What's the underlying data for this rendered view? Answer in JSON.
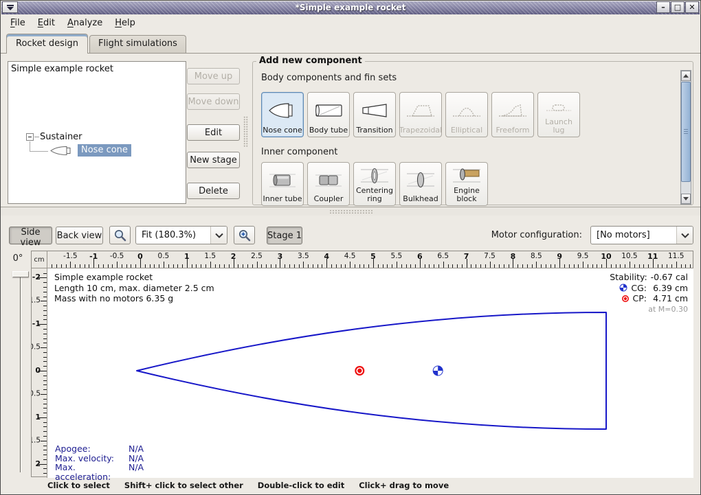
{
  "window": {
    "title": "*Simple example rocket",
    "controls": {
      "minimize": "–",
      "maximize": "□",
      "close": "✕"
    }
  },
  "menubar": {
    "items": [
      {
        "label": "File",
        "mnemonic": 0
      },
      {
        "label": "Edit",
        "mnemonic": 0
      },
      {
        "label": "Analyze",
        "mnemonic": 0
      },
      {
        "label": "Help",
        "mnemonic": 0
      }
    ]
  },
  "tabs": [
    {
      "label": "Rocket design",
      "active": true
    },
    {
      "label": "Flight simulations",
      "active": false
    }
  ],
  "tree": {
    "root": "Simple example rocket",
    "stage": "Sustainer",
    "selected_component": "Nose cone"
  },
  "actions": {
    "move_up": "Move up",
    "move_down": "Move down",
    "edit": "Edit",
    "new_stage": "New stage",
    "delete": "Delete"
  },
  "add_component": {
    "title": "Add new component",
    "body_label": "Body components and fin sets",
    "body_buttons": [
      {
        "label": "Nose cone",
        "state": "selected"
      },
      {
        "label": "Body tube",
        "state": "normal"
      },
      {
        "label": "Transition",
        "state": "normal"
      },
      {
        "label": "Trapezoidal",
        "state": "disabled"
      },
      {
        "label": "Elliptical",
        "state": "disabled"
      },
      {
        "label": "Freeform",
        "state": "disabled"
      },
      {
        "label": "Launch lug",
        "state": "disabled"
      }
    ],
    "inner_label": "Inner component",
    "inner_buttons": [
      {
        "label": "Inner tube",
        "state": "normal"
      },
      {
        "label": "Coupler",
        "state": "normal"
      },
      {
        "label": "Centering ring",
        "state": "normal"
      },
      {
        "label": "Bulkhead",
        "state": "normal"
      },
      {
        "label": "Engine block",
        "state": "normal"
      }
    ]
  },
  "view_toolbar": {
    "side_view": "Side view",
    "back_view": "Back view",
    "zoom_value": "Fit (180.3%)",
    "stage_button": "Stage 1",
    "motor_config_label": "Motor configuration:",
    "motor_config_value": "[No motors]"
  },
  "rotation": {
    "angle": "0°"
  },
  "rulers": {
    "unit": "cm",
    "top_labels": [
      -1.5,
      -1,
      -0.5,
      0,
      0.5,
      1,
      1.5,
      2,
      2.5,
      3,
      3.5,
      4,
      4.5,
      5,
      5.5,
      6,
      6.5,
      7,
      7.5,
      8,
      8.5,
      9,
      9.5,
      10,
      10.5,
      11,
      11.5
    ],
    "left_labels": [
      -2,
      -1.5,
      -1,
      -0.5,
      0,
      0.5,
      1,
      1.5,
      2
    ]
  },
  "canvas": {
    "info_lines": [
      "Simple example rocket",
      "Length 10 cm, max. diameter 2.5 cm",
      "Mass with no motors 6.35 g"
    ],
    "stability_label": "Stability:",
    "stability_value": "-0.67 cal",
    "cg_label": "CG:",
    "cg_value": "6.39 cm",
    "cg_cm": 6.39,
    "cp_label": "CP:",
    "cp_value": "4.71 cm",
    "cp_cm": 4.71,
    "mach_note": "at M=0.30",
    "rocket": {
      "length_cm": 10,
      "max_diameter_cm": 2.5,
      "zoom": "180.3%"
    },
    "flight": [
      {
        "label": "Apogee:",
        "value": "N/A"
      },
      {
        "label": "Max. velocity:",
        "value": "N/A"
      },
      {
        "label": "Max. acceleration:",
        "value": "N/A"
      }
    ]
  },
  "statusbar": {
    "hints": [
      "Click to select",
      "Shift+ click to select other",
      "Double-click to edit",
      "Click+ drag to move"
    ]
  },
  "colors": {
    "titlebar": "#7a7899",
    "selection_blue": "#7b99bf",
    "component_selected_bg": "#dce9f5",
    "rocket_outline": "#1717c8",
    "cg_marker_blue": "#2233cc",
    "cp_marker_red": "#ee1111",
    "flight_text_navy": "#1c1c90",
    "disabled_text": "#b3afa7"
  }
}
